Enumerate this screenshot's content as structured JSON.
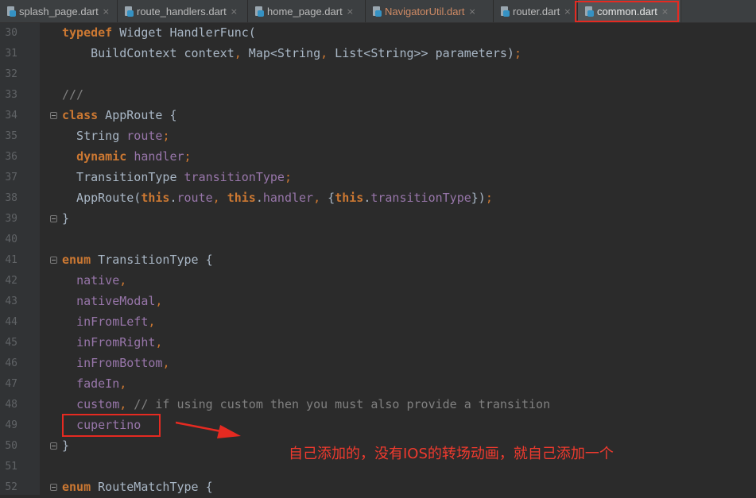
{
  "tabs": [
    {
      "label": "splash_page.dart",
      "close": "×",
      "modified": false,
      "active": false
    },
    {
      "label": "route_handlers.dart",
      "close": "×",
      "modified": false,
      "active": false
    },
    {
      "label": "home_page.dart",
      "close": "×",
      "modified": false,
      "active": false
    },
    {
      "label": "NavigatorUtil.dart",
      "close": "×",
      "modified": true,
      "active": false
    },
    {
      "label": "router.dart",
      "close": "×",
      "modified": false,
      "active": false
    },
    {
      "label": "common.dart",
      "close": "×",
      "modified": false,
      "active": true
    }
  ],
  "code_lines": [
    {
      "num": "30",
      "fold": false,
      "segs": [
        [
          "kw",
          "typedef"
        ],
        [
          "p",
          " Widget HandlerFunc("
        ]
      ]
    },
    {
      "num": "31",
      "fold": false,
      "segs": [
        [
          "p",
          "    BuildContext context"
        ],
        [
          "punc",
          ","
        ],
        [
          "p",
          " Map<String"
        ],
        [
          "punc",
          ","
        ],
        [
          "p",
          " List<String>> parameters)"
        ],
        [
          "punc",
          ";"
        ]
      ]
    },
    {
      "num": "32",
      "fold": false,
      "segs": []
    },
    {
      "num": "33",
      "fold": false,
      "segs": [
        [
          "cmt",
          "///"
        ]
      ]
    },
    {
      "num": "34",
      "fold": true,
      "segs": [
        [
          "kw",
          "class"
        ],
        [
          "p",
          " AppRoute {"
        ]
      ]
    },
    {
      "num": "35",
      "fold": false,
      "segs": [
        [
          "p",
          "  String "
        ],
        [
          "fld",
          "route"
        ],
        [
          "punc",
          ";"
        ]
      ]
    },
    {
      "num": "36",
      "fold": false,
      "segs": [
        [
          "p",
          "  "
        ],
        [
          "kw",
          "dynamic"
        ],
        [
          "p",
          " "
        ],
        [
          "fld",
          "handler"
        ],
        [
          "punc",
          ";"
        ]
      ]
    },
    {
      "num": "37",
      "fold": false,
      "segs": [
        [
          "p",
          "  TransitionType "
        ],
        [
          "fld",
          "transitionType"
        ],
        [
          "punc",
          ";"
        ]
      ]
    },
    {
      "num": "38",
      "fold": false,
      "segs": [
        [
          "p",
          "  AppRoute("
        ],
        [
          "kw",
          "this"
        ],
        [
          "p",
          "."
        ],
        [
          "fld",
          "route"
        ],
        [
          "punc",
          ","
        ],
        [
          "p",
          " "
        ],
        [
          "kw",
          "this"
        ],
        [
          "p",
          "."
        ],
        [
          "fld",
          "handler"
        ],
        [
          "punc",
          ","
        ],
        [
          "p",
          " {"
        ],
        [
          "kw",
          "this"
        ],
        [
          "p",
          "."
        ],
        [
          "fld",
          "transitionType"
        ],
        [
          "p",
          "})"
        ],
        [
          "punc",
          ";"
        ]
      ]
    },
    {
      "num": "39",
      "fold": true,
      "segs": [
        [
          "p",
          "}"
        ]
      ]
    },
    {
      "num": "40",
      "fold": false,
      "segs": []
    },
    {
      "num": "41",
      "fold": true,
      "segs": [
        [
          "kw",
          "enum"
        ],
        [
          "p",
          " TransitionType {"
        ]
      ]
    },
    {
      "num": "42",
      "fold": false,
      "segs": [
        [
          "p",
          "  "
        ],
        [
          "fld",
          "native"
        ],
        [
          "punc",
          ","
        ]
      ]
    },
    {
      "num": "43",
      "fold": false,
      "segs": [
        [
          "p",
          "  "
        ],
        [
          "fld",
          "nativeModal"
        ],
        [
          "punc",
          ","
        ]
      ]
    },
    {
      "num": "44",
      "fold": false,
      "segs": [
        [
          "p",
          "  "
        ],
        [
          "fld",
          "inFromLeft"
        ],
        [
          "punc",
          ","
        ]
      ]
    },
    {
      "num": "45",
      "fold": false,
      "segs": [
        [
          "p",
          "  "
        ],
        [
          "fld",
          "inFromRight"
        ],
        [
          "punc",
          ","
        ]
      ]
    },
    {
      "num": "46",
      "fold": false,
      "segs": [
        [
          "p",
          "  "
        ],
        [
          "fld",
          "inFromBottom"
        ],
        [
          "punc",
          ","
        ]
      ]
    },
    {
      "num": "47",
      "fold": false,
      "segs": [
        [
          "p",
          "  "
        ],
        [
          "fld",
          "fadeIn"
        ],
        [
          "punc",
          ","
        ]
      ]
    },
    {
      "num": "48",
      "fold": false,
      "segs": [
        [
          "p",
          "  "
        ],
        [
          "fld",
          "custom"
        ],
        [
          "punc",
          ","
        ],
        [
          "cmt",
          " // if using custom then you must also provide a transition"
        ]
      ]
    },
    {
      "num": "49",
      "fold": false,
      "segs": [
        [
          "p",
          "  "
        ],
        [
          "fld",
          "cupertino"
        ]
      ]
    },
    {
      "num": "50",
      "fold": true,
      "segs": [
        [
          "p",
          "}"
        ]
      ]
    },
    {
      "num": "51",
      "fold": false,
      "segs": []
    },
    {
      "num": "52",
      "fold": true,
      "segs": [
        [
          "kw",
          "enum"
        ],
        [
          "p",
          " RouteMatchType {"
        ]
      ]
    }
  ],
  "annotation": {
    "text": "自己添加的，没有IOS的转场动画，就自己添加一个",
    "color": "#f03a2e"
  },
  "colors": {
    "background": "#2b2b2b",
    "keyword": "#cc7832",
    "field": "#9876aa",
    "plain": "#a9b7c6",
    "comment": "#808080",
    "highlight_box": "#e52a21"
  }
}
